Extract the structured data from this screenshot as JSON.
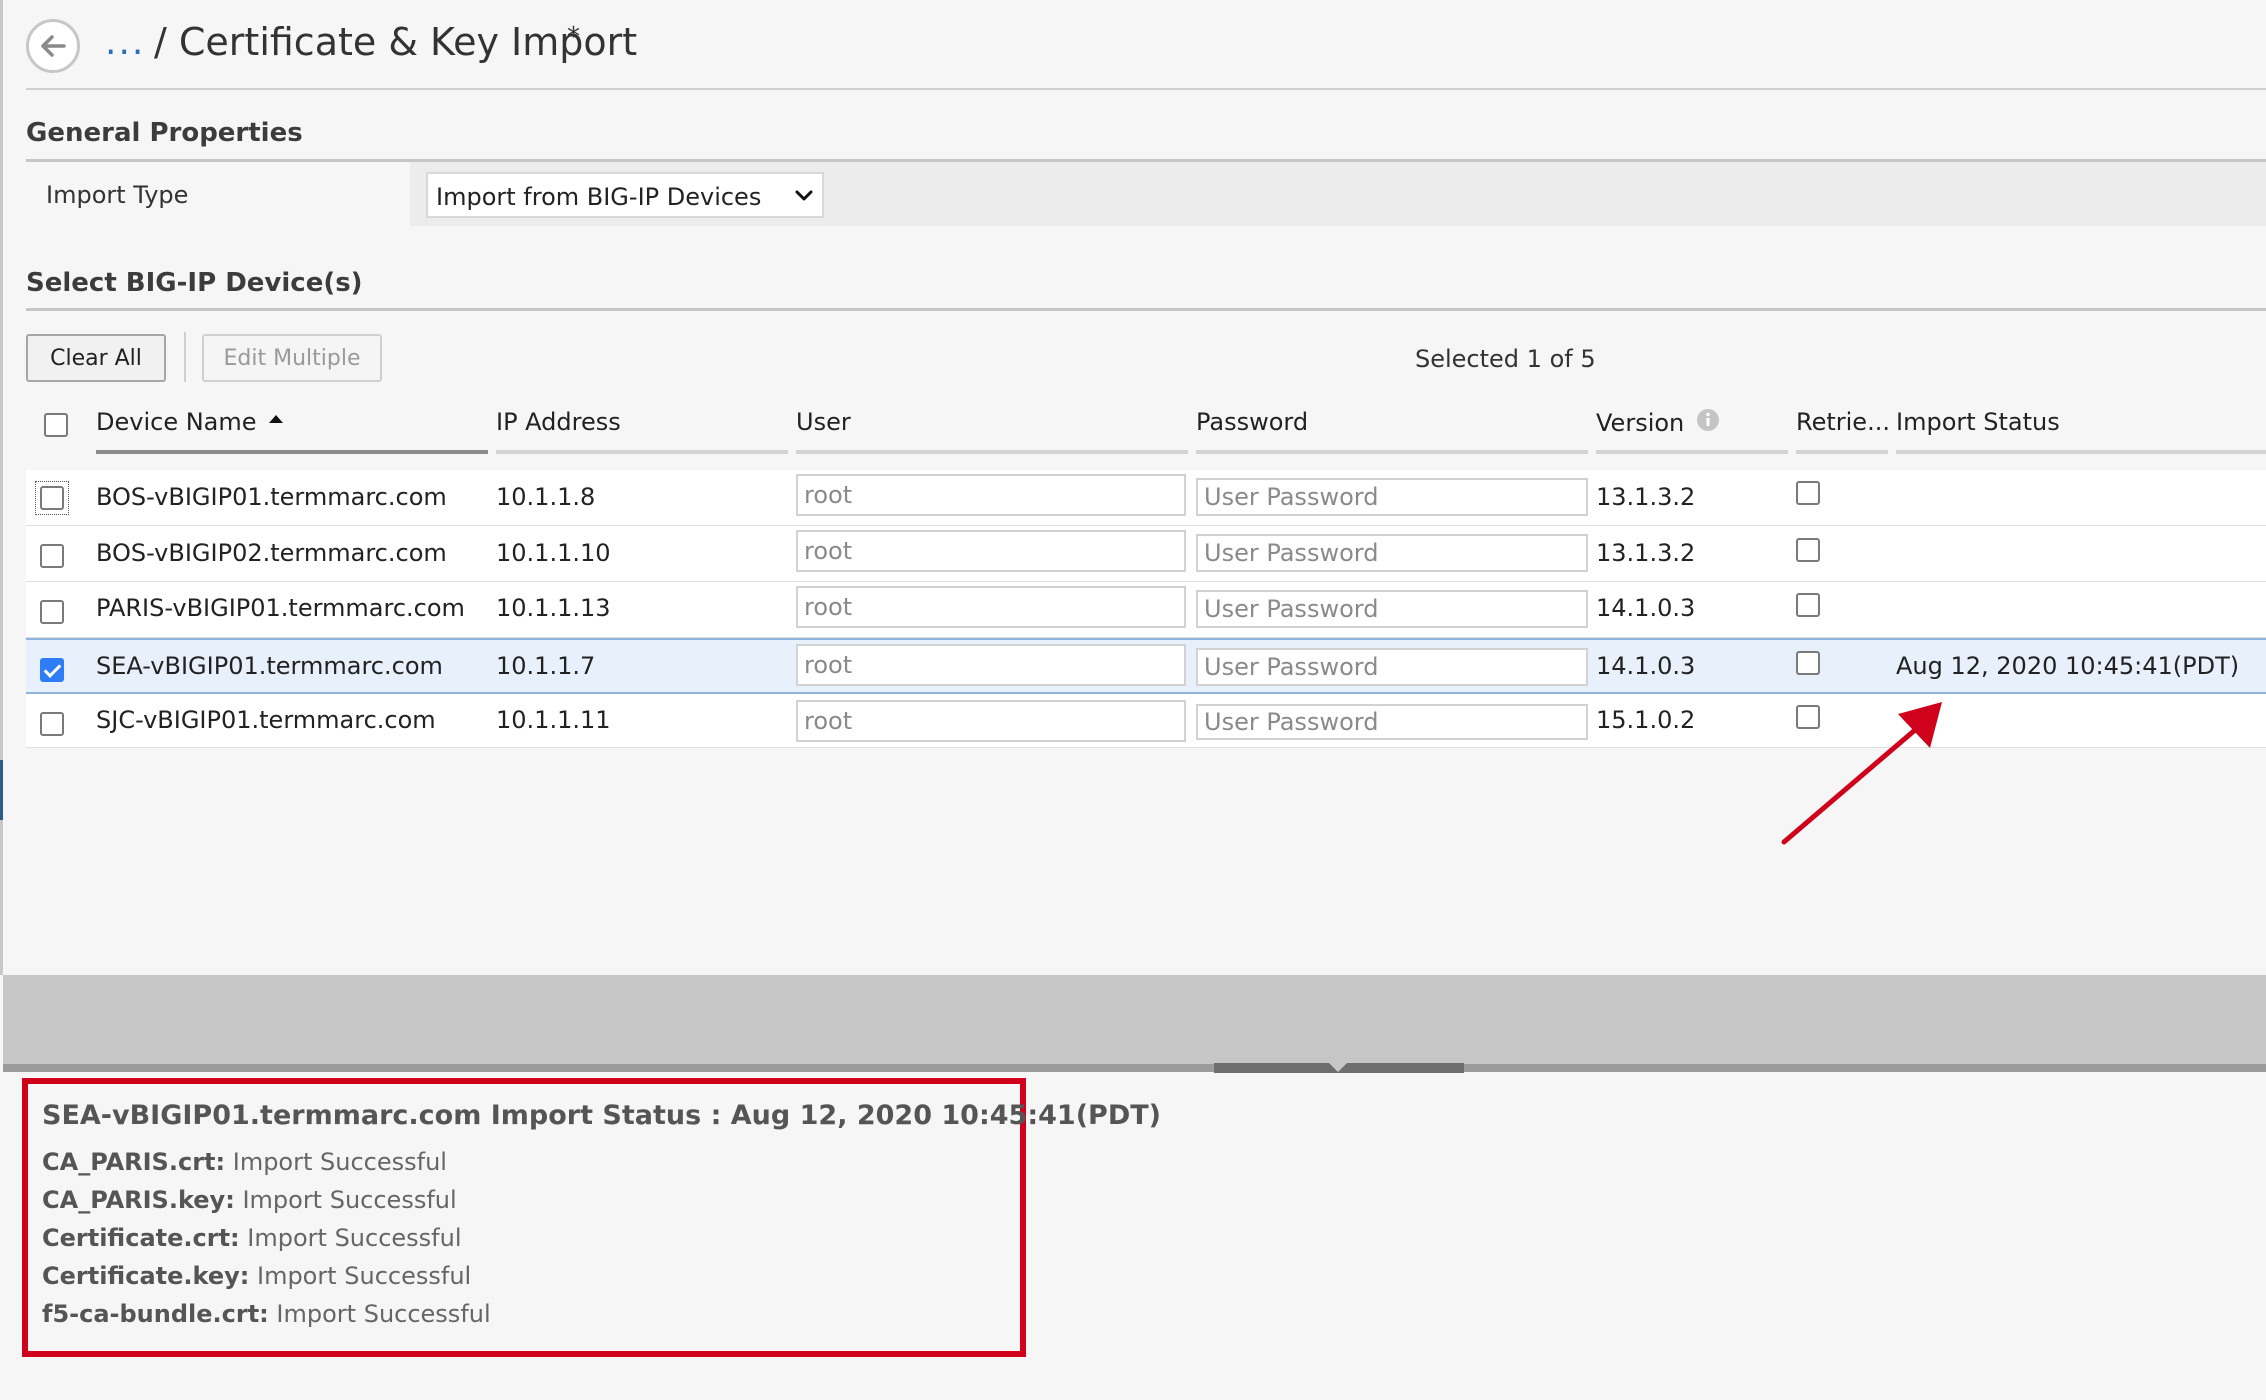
{
  "header": {
    "breadcrumb_ellipsis": "...",
    "title": "/ Certificate & Key Import",
    "dirty_marker": "*"
  },
  "general": {
    "heading": "General Properties",
    "import_type_label": "Import Type",
    "import_type_value": "Import from BIG-IP Devices"
  },
  "devices": {
    "heading": "Select BIG-IP Device(s)",
    "clear_all_label": "Clear All",
    "edit_multiple_label": "Edit Multiple",
    "selected_text": "Selected 1 of 5",
    "columns": {
      "device_name": "Device Name",
      "ip": "IP Address",
      "user": "User",
      "password": "Password",
      "version": "Version",
      "retrieve": "Retrie...",
      "import_status": "Import Status"
    },
    "sort_column": "device_name",
    "sort_direction": "ascending",
    "password_placeholder": "User Password",
    "rows": [
      {
        "name": "BOS-vBIGIP01.termmarc.com",
        "ip": "10.1.1.8",
        "user": "root",
        "version": "13.1.3.2",
        "selected": false,
        "retrieve": false,
        "status": ""
      },
      {
        "name": "BOS-vBIGIP02.termmarc.com",
        "ip": "10.1.1.10",
        "user": "root",
        "version": "13.1.3.2",
        "selected": false,
        "retrieve": false,
        "status": ""
      },
      {
        "name": "PARIS-vBIGIP01.termmarc.com",
        "ip": "10.1.1.13",
        "user": "root",
        "version": "14.1.0.3",
        "selected": false,
        "retrieve": false,
        "status": ""
      },
      {
        "name": "SEA-vBIGIP01.termmarc.com",
        "ip": "10.1.1.7",
        "user": "root",
        "version": "14.1.0.3",
        "selected": true,
        "retrieve": false,
        "status": "Aug 12, 2020 10:45:41(PDT)"
      },
      {
        "name": "SJC-vBIGIP01.termmarc.com",
        "ip": "10.1.1.11",
        "user": "root",
        "version": "15.1.0.2",
        "selected": false,
        "retrieve": false,
        "status": ""
      }
    ]
  },
  "import_status_panel": {
    "title": "SEA-vBIGIP01.termmarc.com Import Status : Aug 12, 2020 10:45:41(PDT)",
    "items": [
      {
        "file": "CA_PARIS.crt:",
        "result": "Import Successful"
      },
      {
        "file": "CA_PARIS.key:",
        "result": "Import Successful"
      },
      {
        "file": "Certificate.crt:",
        "result": "Import Successful"
      },
      {
        "file": "Certificate.key:",
        "result": "Import Successful"
      },
      {
        "file": "f5-ca-bundle.crt:",
        "result": "Import Successful"
      }
    ]
  },
  "colors": {
    "accent_blue": "#2f7df6",
    "annotation_red": "#d0021b",
    "selected_row_bg": "#e8f1fb"
  },
  "icons": {
    "back": "back-arrow-icon",
    "sort": "sort-ascending-icon",
    "info": "info-icon",
    "dropdown": "chevron-down-icon",
    "annotation": "red-arrow-icon"
  }
}
